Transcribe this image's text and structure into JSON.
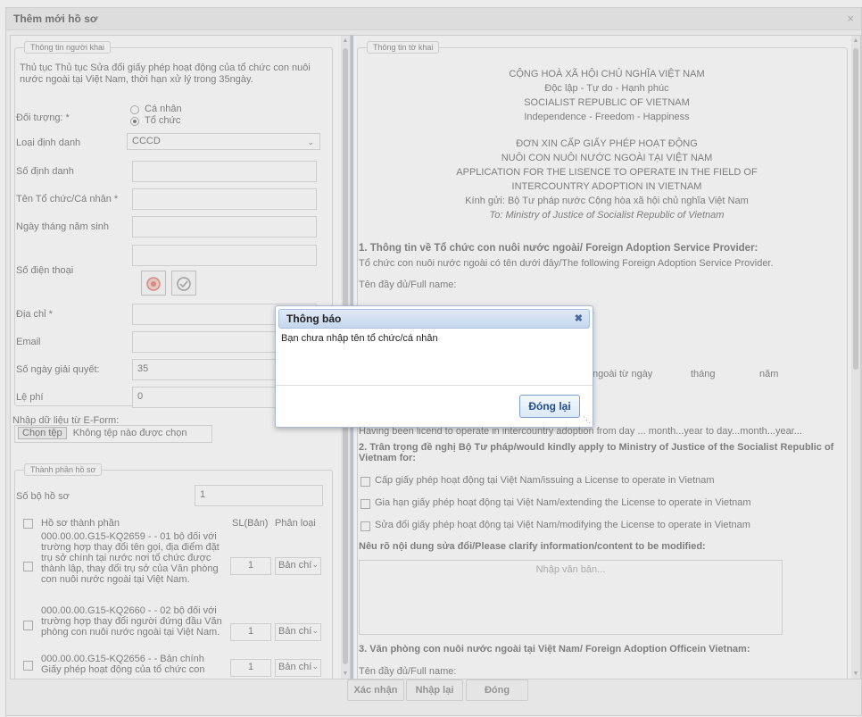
{
  "window": {
    "title": "Thêm mới hồ sơ",
    "close_icon": "×"
  },
  "left": {
    "legend": "Thông tin người khai",
    "procedure": "Thủ tục Thủ tục Sửa đổi giấy phép hoạt động của tổ chức con nuôi nước ngoài tại Việt Nam, thời hạn xử lý trong 35ngày.",
    "doi_tuong_label": "Đối tượng: *",
    "radio_individual": "Cá nhân",
    "radio_org": "Tổ chức",
    "loai_dinh_danh_label": "Loại định danh",
    "loai_dinh_danh_value": "CCCD",
    "so_dinh_danh_label": "Số định danh",
    "ten_label": "Tên Tổ chức/Cá nhân *",
    "ngay_sinh_label": "Ngày tháng năm sinh",
    "sdt_label": "Số điện thoại",
    "dia_chi_label": "Địa chỉ *",
    "email_label": "Email",
    "so_ngay_label": "Số ngày giải quyết:",
    "so_ngay_value": "35",
    "le_phi_label": "Lệ phí",
    "le_phi_value": "0",
    "eform_label": "Nhập dữ liệu từ E-Form:",
    "choose_file": "Chọn tệp",
    "no_file": "Không tệp nào được chọn",
    "thanh_phan_legend": "Thành phần hồ sơ",
    "so_bo_label": "Số bộ hồ sơ",
    "so_bo_value": "1",
    "col_hoso": "Hồ sơ thành phần",
    "col_sl": "SL(Bản)",
    "col_loai": "Phân loại",
    "docs": [
      {
        "text": "000.00.00.G15-KQ2659 - - 01 bộ đối với trường hợp thay đổi tên gọi, địa điểm đặt trụ sở chính tại nước nơi tổ chức được thành lập, thay đổi trụ sở của Văn phòng con nuôi nước ngoài tại Việt Nam.",
        "qty": "1",
        "type": "Bản chí"
      },
      {
        "text": "000.00.00.G15-KQ2660 - - 02 bộ đối với trường hợp thay đổi người đứng đầu Văn phòng con nuôi nước ngoài tại Việt Nam.",
        "qty": "1",
        "type": "Bản chí"
      },
      {
        "text": "000.00.00.G15-KQ2656 - - Bản chính Giấy phép hoạt động của tổ chức con",
        "qty": "1",
        "type": "Bản chí"
      }
    ]
  },
  "right": {
    "legend": "Thông tin tờ khai",
    "header_lines": [
      "CỘNG HOÀ XÃ HỘI CHỦ NGHĨA VIỆT NAM",
      "Độc lập - Tự do - Hạnh phúc",
      "SOCIALIST REPUBLIC OF VIETNAM",
      "Independence - Freedom - Happiness"
    ],
    "form_title_lines": [
      "ĐƠN XIN CẤP GIẤY PHÉP HOẠT ĐỘNG",
      "NUÔI CON NUÔI NƯỚC NGOÀI TẠI VIỆT NAM",
      "APPLICATION FOR THE LISENCE TO OPERATE IN THE FIELD OF",
      "INTERCOUNTRY ADOPTION IN VIETNAM"
    ],
    "kinh_gui": "Kính gửi: Bộ Tư pháp nước Cộng hòa xã hội chủ nghĩa Việt Nam",
    "to_line": "To: Ministry of Justice of Socialist Republic of Vietnam",
    "s1_title": "1. Thông tin về Tổ chức con nuôi nước ngoài/ Foreign Adoption Service Provider:",
    "s1_sub": "Tổ chức con nuôi nước ngoài có tên dưới đây/The following Foreign Adoption Service Provider.",
    "full_name": "Tên đầy đủ/Full name:",
    "since_day": "ngoài từ ngày",
    "month": "tháng",
    "year": "năm",
    "licensed_line": "Having been licend to operate in intercountry adoption from day ... month...year to day...month...year...",
    "s2_title": "2. Trân trọng đề nghị Bộ Tư pháp/would kindly apply to Ministry of Justice of the Socialist Republic of Vietnam for:",
    "opt1": "Cấp giấy phép hoạt động tại Việt Nam/issuing a License to operate in Vietnam",
    "opt2": "Gia hạn giấy phép hoạt động tại Việt Nam/extending the License to operate in Vietnam",
    "opt3": "Sửa đổi giấy phép hoạt động tại Việt Nam/modifying the License to operate in Vietnam",
    "clarify": "Nêu rõ nội dung sửa đổi/Please clarify information/content to be modified:",
    "textarea_placeholder": "Nhập văn bản...",
    "s3_title": "3. Văn phòng con nuôi nước ngoài tại Việt Nam/ Foreign Adoption Officein Vietnam:",
    "s3_full_name": "Tên đầy đủ/Full name:"
  },
  "footer": {
    "confirm": "Xác nhận",
    "reenter": "Nhập lại",
    "close": "Đóng"
  },
  "dialog": {
    "title": "Thông báo",
    "close_icon": "✖",
    "message": "Bạn chưa nhập tên tổ chức/cá nhân",
    "ok": "Đóng lại"
  }
}
